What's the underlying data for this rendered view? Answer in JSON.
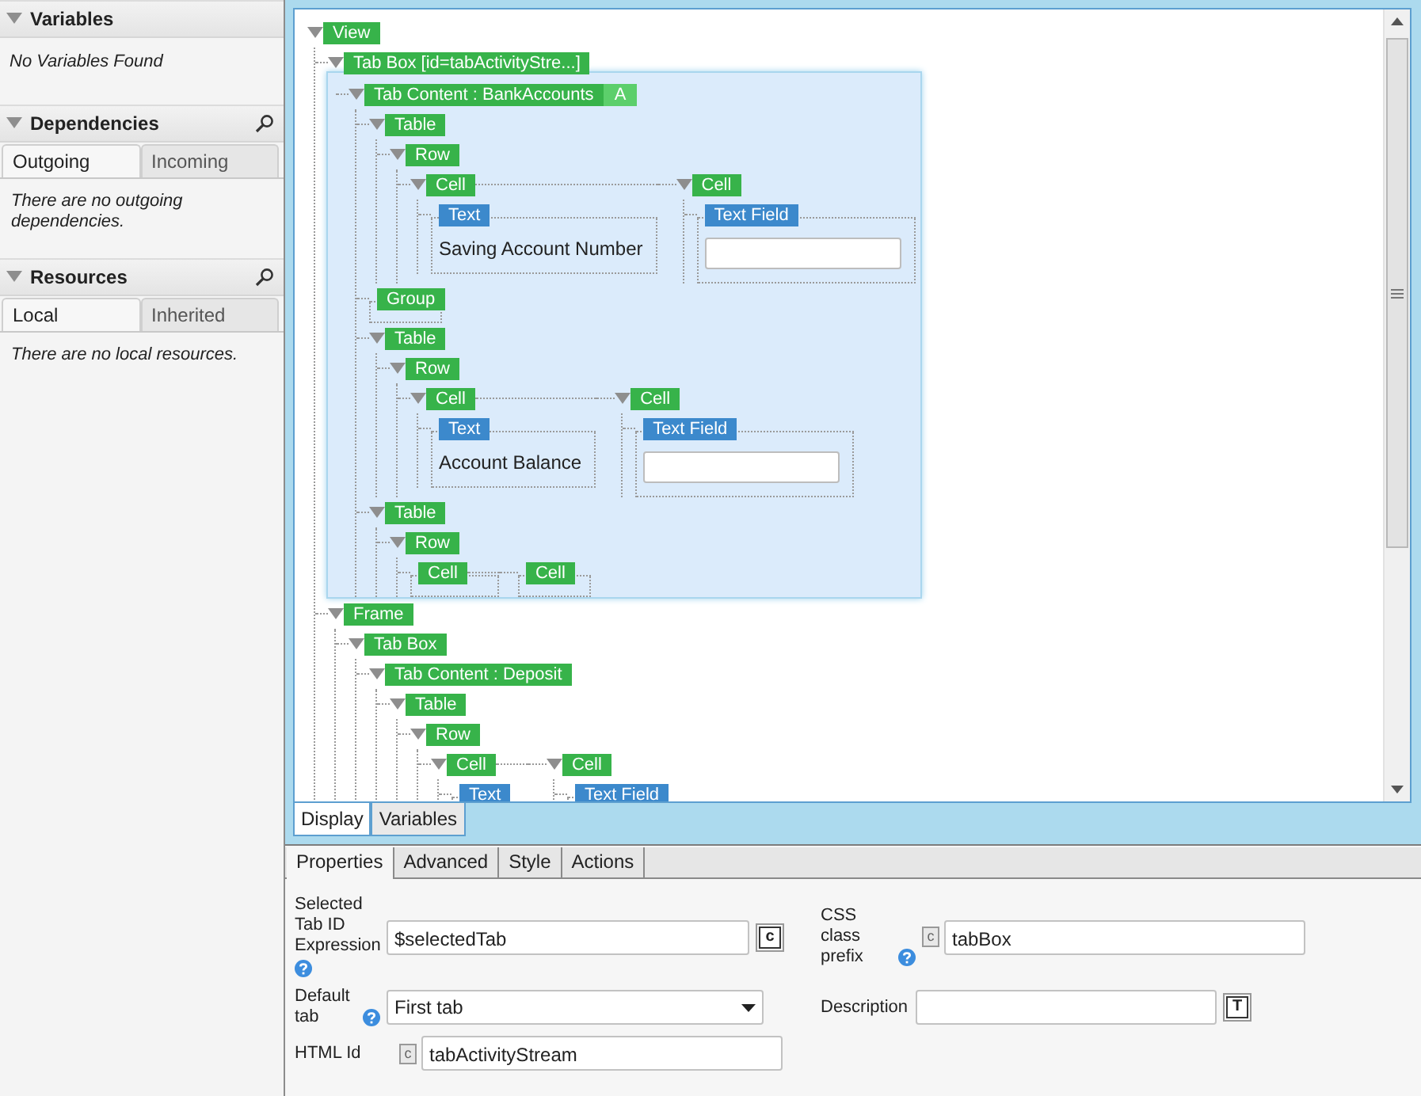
{
  "sidebar": [
    {
      "kind": "plain",
      "title": "Variables",
      "expanded": true,
      "message": "No Variables Found"
    },
    {
      "kind": "tabbed",
      "title": "Dependencies",
      "expanded": true,
      "tabs": [
        {
          "label": "Outgoing",
          "selected": true
        },
        {
          "label": "Incoming",
          "selected": false
        }
      ],
      "message": "There are no outgoing dependencies."
    },
    {
      "kind": "tabbed",
      "title": "Resources",
      "expanded": true,
      "tabs": [
        {
          "label": "Local",
          "selected": true
        },
        {
          "label": "Inherited",
          "selected": false
        }
      ],
      "message": "There are no local resources."
    }
  ],
  "designer": {
    "tree": {
      "label": "View",
      "kind": "container",
      "selected": false,
      "expanded": true,
      "children": [
        {
          "label": "Tab Box [id=tabActivityStre...]",
          "kind": "container",
          "selected": false,
          "expanded": true,
          "children": [
            {
              "label": "Tab Content : BankAccounts",
              "badge": "A",
              "kind": "container",
              "selected": true,
              "expanded": true,
              "children": [
                {
                  "label": "Table",
                  "kind": "container",
                  "selected": false,
                  "expanded": true,
                  "children": [
                    {
                      "label": "Row",
                      "kind": "row",
                      "selected": false,
                      "expanded": true,
                      "children": [
                        {
                          "label": "Cell",
                          "kind": "container",
                          "selected": false,
                          "expanded": true,
                          "children": [
                            {
                              "label": "Text",
                              "kind": "text",
                              "selected": false,
                              "text": "Saving Account Number"
                            }
                          ]
                        },
                        {
                          "label": "Cell",
                          "kind": "container",
                          "selected": false,
                          "expanded": true,
                          "children": [
                            {
                              "label": "Text Field",
                              "kind": "textfield",
                              "selected": false
                            }
                          ]
                        }
                      ]
                    }
                  ]
                },
                {
                  "label": "Group",
                  "kind": "empty",
                  "selected": false
                },
                {
                  "label": "Table",
                  "kind": "container",
                  "selected": false,
                  "expanded": true,
                  "children": [
                    {
                      "label": "Row",
                      "kind": "row",
                      "selected": false,
                      "expanded": true,
                      "children": [
                        {
                          "label": "Cell",
                          "kind": "container",
                          "selected": false,
                          "expanded": true,
                          "children": [
                            {
                              "label": "Text",
                              "kind": "text",
                              "selected": false,
                              "text": "Account Balance"
                            }
                          ]
                        },
                        {
                          "label": "Cell",
                          "kind": "container",
                          "selected": false,
                          "expanded": true,
                          "children": [
                            {
                              "label": "Text Field",
                              "kind": "textfield",
                              "selected": false
                            }
                          ]
                        }
                      ]
                    }
                  ]
                },
                {
                  "label": "Table",
                  "kind": "container",
                  "selected": false,
                  "expanded": true,
                  "children": [
                    {
                      "label": "Row",
                      "kind": "row",
                      "selected": false,
                      "expanded": true,
                      "children": [
                        {
                          "label": "Cell",
                          "kind": "empty",
                          "selected": false
                        },
                        {
                          "label": "Cell",
                          "kind": "empty",
                          "selected": false
                        }
                      ]
                    }
                  ]
                }
              ]
            }
          ]
        },
        {
          "label": "Frame",
          "kind": "container",
          "selected": false,
          "expanded": true,
          "children": [
            {
              "label": "Tab Box",
              "kind": "container",
              "selected": false,
              "expanded": true,
              "children": [
                {
                  "label": "Tab Content : Deposit",
                  "kind": "container",
                  "selected": false,
                  "expanded": true,
                  "children": [
                    {
                      "label": "Table",
                      "kind": "container",
                      "selected": false,
                      "expanded": true,
                      "children": [
                        {
                          "label": "Row",
                          "kind": "row",
                          "selected": false,
                          "expanded": true,
                          "children": [
                            {
                              "label": "Cell",
                              "kind": "container",
                              "selected": false,
                              "expanded": true,
                              "children": [
                                {
                                  "label": "Text",
                                  "kind": "text",
                                  "selected": false
                                }
                              ]
                            },
                            {
                              "label": "Cell",
                              "kind": "container",
                              "selected": false,
                              "expanded": true,
                              "children": [
                                {
                                  "label": "Text Field",
                                  "kind": "text",
                                  "selected": false
                                }
                              ]
                            }
                          ]
                        }
                      ]
                    }
                  ]
                }
              ]
            }
          ]
        }
      ]
    },
    "tabs": [
      {
        "label": "Display",
        "selected": true
      },
      {
        "label": "Variables",
        "selected": false
      }
    ]
  },
  "properties": {
    "tabs": [
      {
        "label": "Properties",
        "selected": true
      },
      {
        "label": "Advanced",
        "selected": false
      },
      {
        "label": "Style",
        "selected": false
      },
      {
        "label": "Actions",
        "selected": false
      }
    ],
    "rows": [
      [
        {
          "label": "Selected Tab ID Expression",
          "help": true,
          "kind": "text",
          "value": "$selectedTab",
          "adornment": {
            "kind": "button",
            "glyph": "c"
          }
        },
        {
          "label": "CSS class prefix",
          "help": true,
          "kind": "text",
          "value": "tabBox",
          "adornment": {
            "kind": "marker",
            "glyph": "c"
          }
        }
      ],
      [
        {
          "label": "Default tab",
          "help": true,
          "kind": "select",
          "value": "First tab"
        },
        {
          "label": "Description",
          "help": false,
          "kind": "text",
          "adornment": {
            "kind": "button",
            "glyph": "T"
          }
        }
      ],
      [
        {
          "label": "HTML Id",
          "help": false,
          "kind": "text",
          "value": "tabActivityStream",
          "adornment": {
            "kind": "marker",
            "glyph": "c"
          }
        }
      ]
    ]
  }
}
